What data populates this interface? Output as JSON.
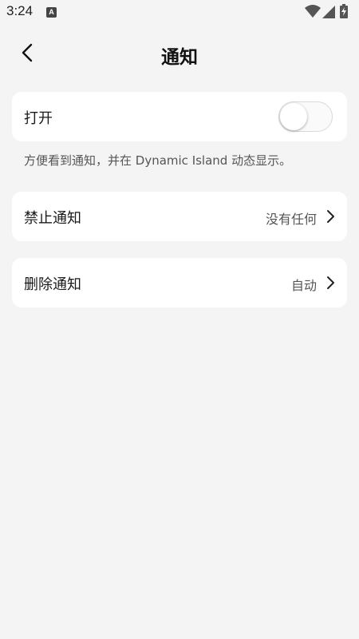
{
  "status_bar": {
    "time": "3:24",
    "notification_badge": "A",
    "icons": [
      "wifi-icon",
      "cellular-signal-icon",
      "battery-charging-icon"
    ]
  },
  "header": {
    "title": "通知",
    "back_icon": "chevron-left-icon"
  },
  "open_row": {
    "label": "打开",
    "toggle_on": false
  },
  "hint_text": "方便看到通知，并在 Dynamic Island 动态显示。",
  "block_row": {
    "label": "禁止通知",
    "value": "没有任何"
  },
  "delete_row": {
    "label": "删除通知",
    "value": "自动"
  },
  "colors": {
    "background": "#f4f4f4",
    "card": "#ffffff",
    "text": "#1a1a1a",
    "secondary_text": "#555555"
  }
}
